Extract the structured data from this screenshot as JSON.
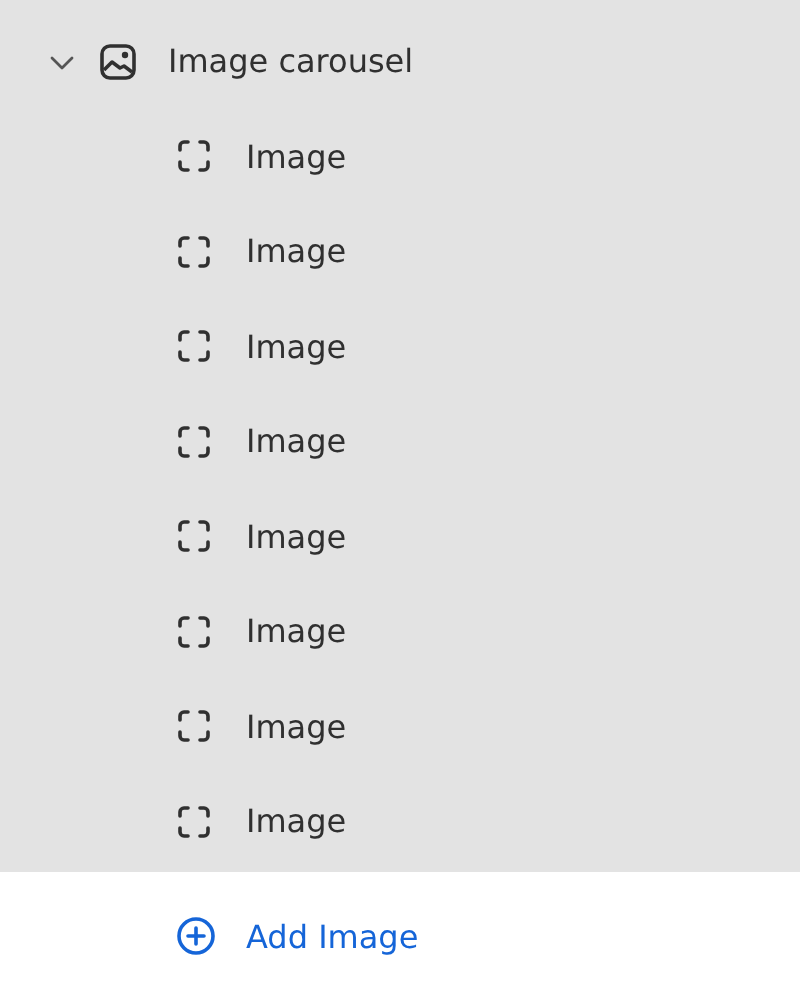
{
  "section": {
    "label": "Image carousel",
    "expanded": true,
    "children": [
      {
        "label": "Image"
      },
      {
        "label": "Image"
      },
      {
        "label": "Image"
      },
      {
        "label": "Image"
      },
      {
        "label": "Image"
      },
      {
        "label": "Image"
      },
      {
        "label": "Image"
      },
      {
        "label": "Image"
      }
    ]
  },
  "add_button": {
    "label": "Add Image"
  }
}
